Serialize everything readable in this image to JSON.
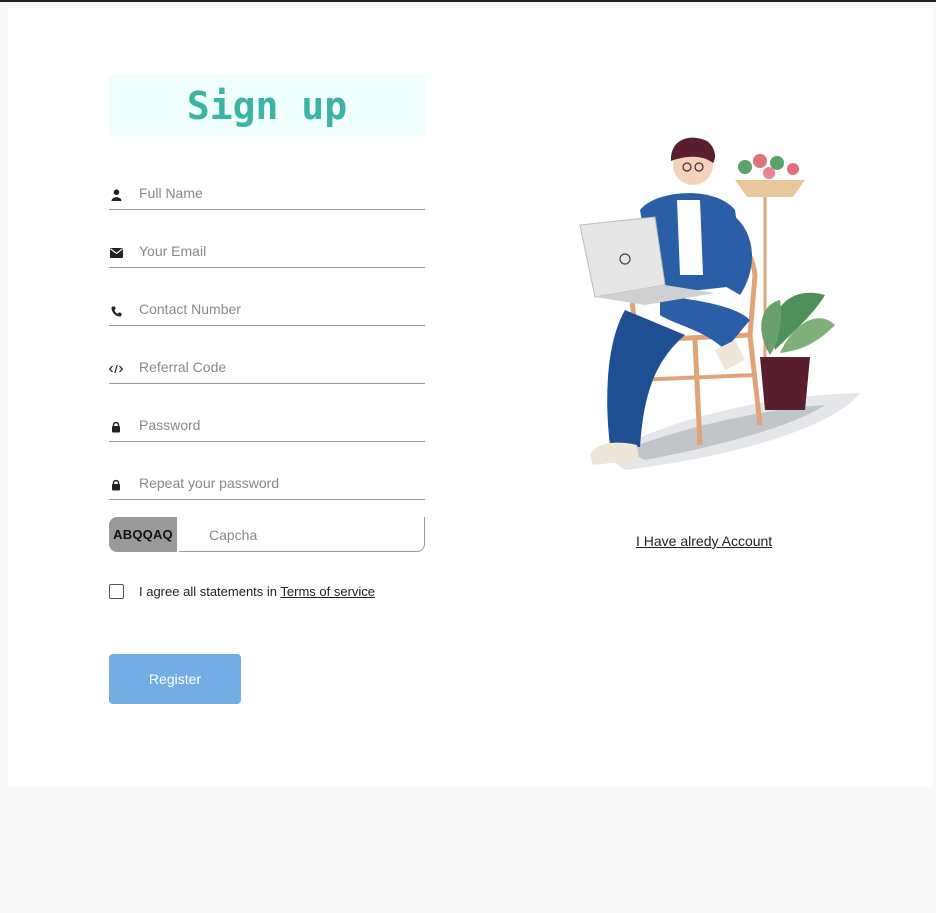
{
  "form": {
    "title": "Sign up",
    "fields": [
      {
        "icon": "user-icon",
        "placeholder": "Full Name",
        "value": ""
      },
      {
        "icon": "envelope-icon",
        "placeholder": "Your Email",
        "value": ""
      },
      {
        "icon": "phone-icon",
        "placeholder": "Contact Number",
        "value": ""
      },
      {
        "icon": "code-icon",
        "placeholder": "Referral Code",
        "value": ""
      },
      {
        "icon": "lock-icon",
        "placeholder": "Password",
        "value": ""
      },
      {
        "icon": "lock-icon",
        "placeholder": "Repeat your password",
        "value": ""
      }
    ],
    "captcha": {
      "code": "ABQQAQ",
      "placeholder": "Capcha"
    },
    "terms": {
      "prefix": "I agree all statements in ",
      "link": "Terms of service"
    },
    "register_label": "Register"
  },
  "side": {
    "login_link": "I Have alredy Account"
  },
  "colors": {
    "title": "#3cb4a4",
    "title_bg": "#f0fffe",
    "button": "#72ade3",
    "captcha_bg": "#9a9a9a"
  }
}
